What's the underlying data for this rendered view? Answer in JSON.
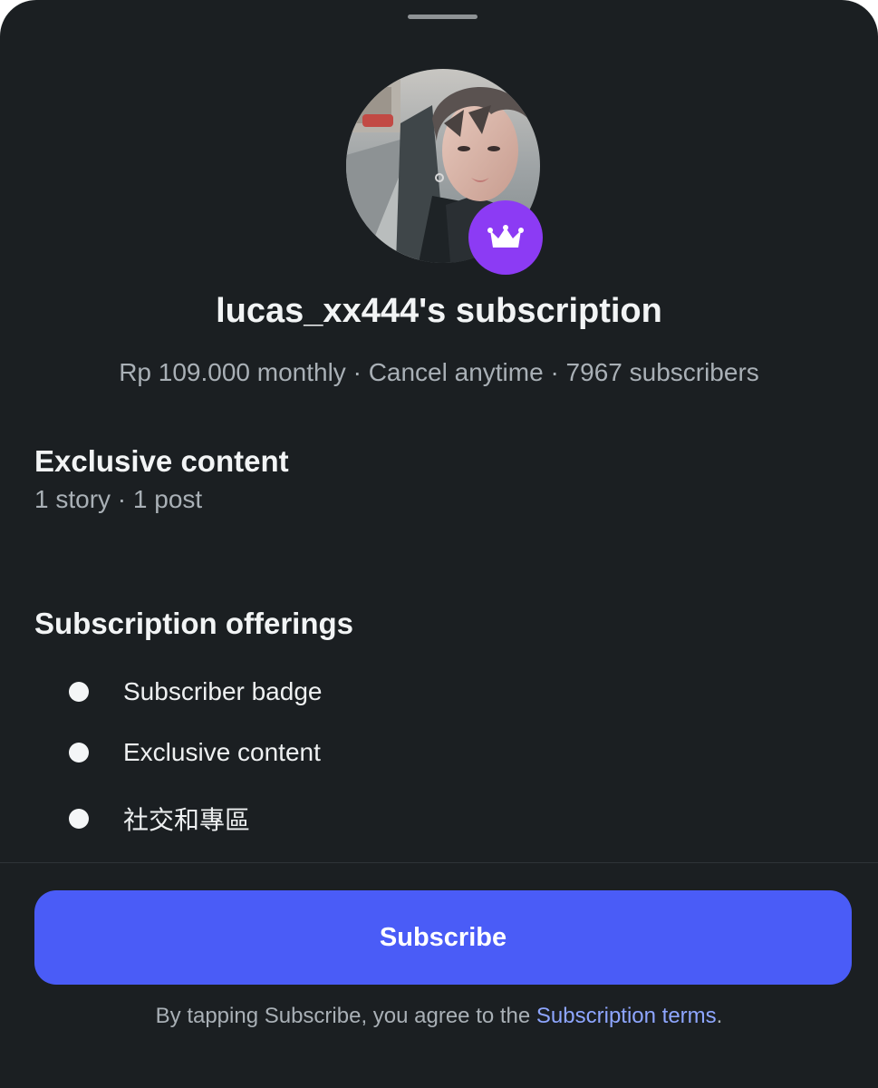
{
  "title": "lucas_xx444's subscription",
  "meta": "Rp 109.000 monthly · Cancel anytime · 7967 subscribers",
  "exclusive": {
    "title": "Exclusive content",
    "summary": "1 story · 1 post"
  },
  "offerings": {
    "title": "Subscription offerings",
    "items": [
      {
        "label": "Subscriber badge"
      },
      {
        "label": "Exclusive content"
      },
      {
        "label": "社交和專區"
      }
    ]
  },
  "subscribe": {
    "label": "Subscribe"
  },
  "terms": {
    "prefix": "By tapping Subscribe, you agree to the ",
    "link": "Subscription terms",
    "suffix": "."
  },
  "icons": {
    "badge": "crown-icon"
  },
  "colors": {
    "background": "#1b1f22",
    "accent": "#4a5cf7",
    "badge": "#8c3bf4",
    "link": "#8ea6ff"
  }
}
